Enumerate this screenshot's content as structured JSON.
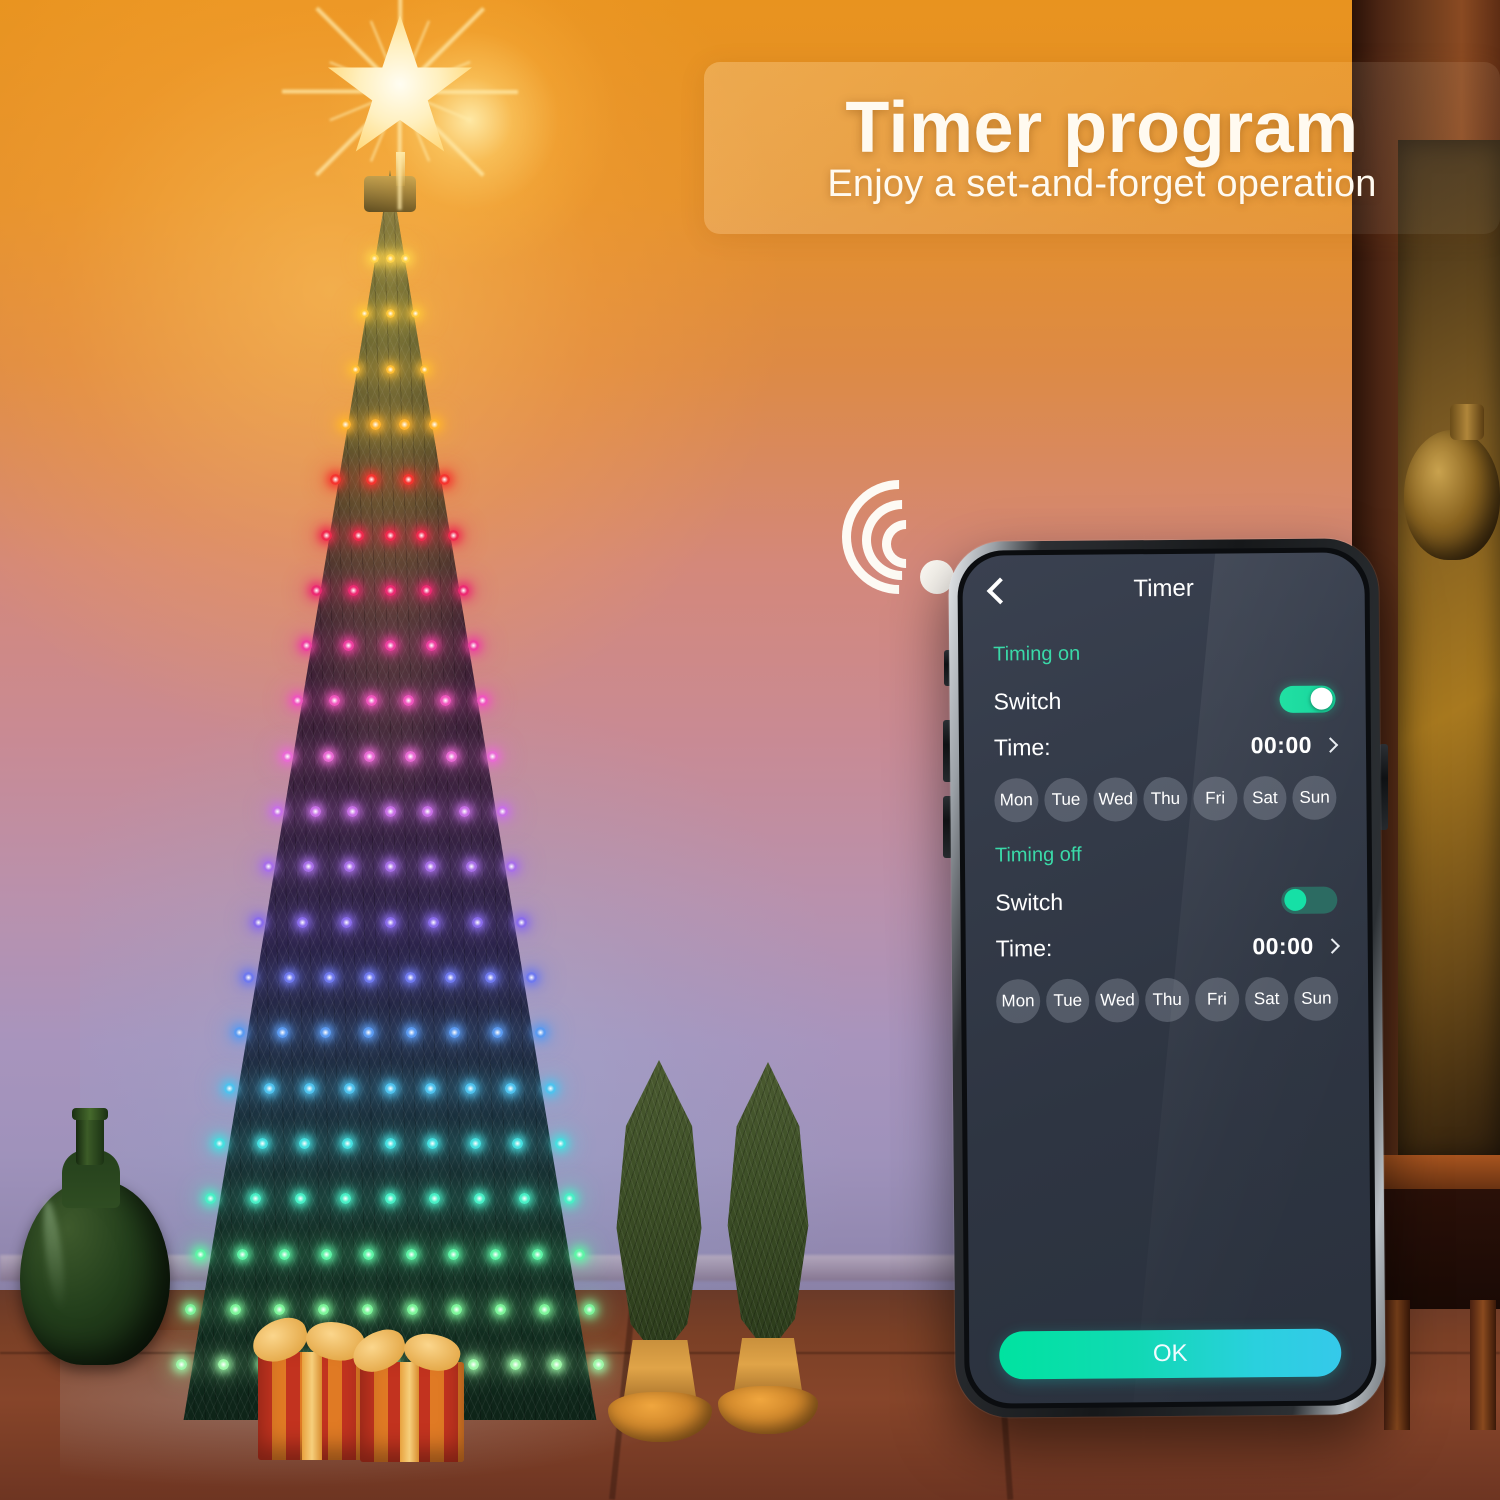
{
  "banner": {
    "title": "Timer program",
    "subtitle": "Enjoy a set-and-forget operation"
  },
  "icons": {
    "wifi": "wifi-signal-icon",
    "back": "chevron-left-icon",
    "chevron": "chevron-right-icon"
  },
  "phone": {
    "nav": {
      "back_label": "",
      "title": "Timer"
    },
    "sections": [
      {
        "heading": "Timing on",
        "switch_label": "Switch",
        "switch_on": true,
        "time_label": "Time:",
        "time_value": "00:00",
        "days": [
          "Mon",
          "Tue",
          "Wed",
          "Thu",
          "Fri",
          "Sat",
          "Sun"
        ]
      },
      {
        "heading": "Timing off",
        "switch_label": "Switch",
        "switch_on": false,
        "time_label": "Time:",
        "time_value": "00:00",
        "days": [
          "Mon",
          "Tue",
          "Wed",
          "Thu",
          "Fri",
          "Sat",
          "Sun"
        ]
      }
    ],
    "ok_label": "OK"
  },
  "colors": {
    "accent_teal": "#3ad9a8",
    "toggle_on": "#1ed7a0",
    "toggle_off_track": "#2c6b62",
    "ok_gradient_start": "#00e3a0",
    "ok_gradient_end": "#35c9ea",
    "screen_bg": "#323946",
    "wall_top": "#e8931f",
    "wall_mid": "#d4887a",
    "wall_bottom": "#9f92bb",
    "floor": "#7b4026"
  },
  "scene": {
    "tree_light_bands": [
      "#ffd34a",
      "#ffc83a",
      "#ffbe33",
      "#ffb42d",
      "#f5352f",
      "#f02a4e",
      "#ec2a72",
      "#ee3fa0",
      "#ef55bd",
      "#e96ad4",
      "#c870e6",
      "#a86fe8",
      "#8a6ceb",
      "#6f79ee",
      "#5b9af0",
      "#4fc2ee",
      "#46dfe0",
      "#48efc6",
      "#5ef4a6",
      "#7df59a",
      "#9df7a8"
    ],
    "star_color": "#fff0c0",
    "bottle_color": "#24401c",
    "gift_colors": [
      "#c2331f",
      "#e07a24"
    ],
    "ribbon_color": "#e8a23e"
  }
}
